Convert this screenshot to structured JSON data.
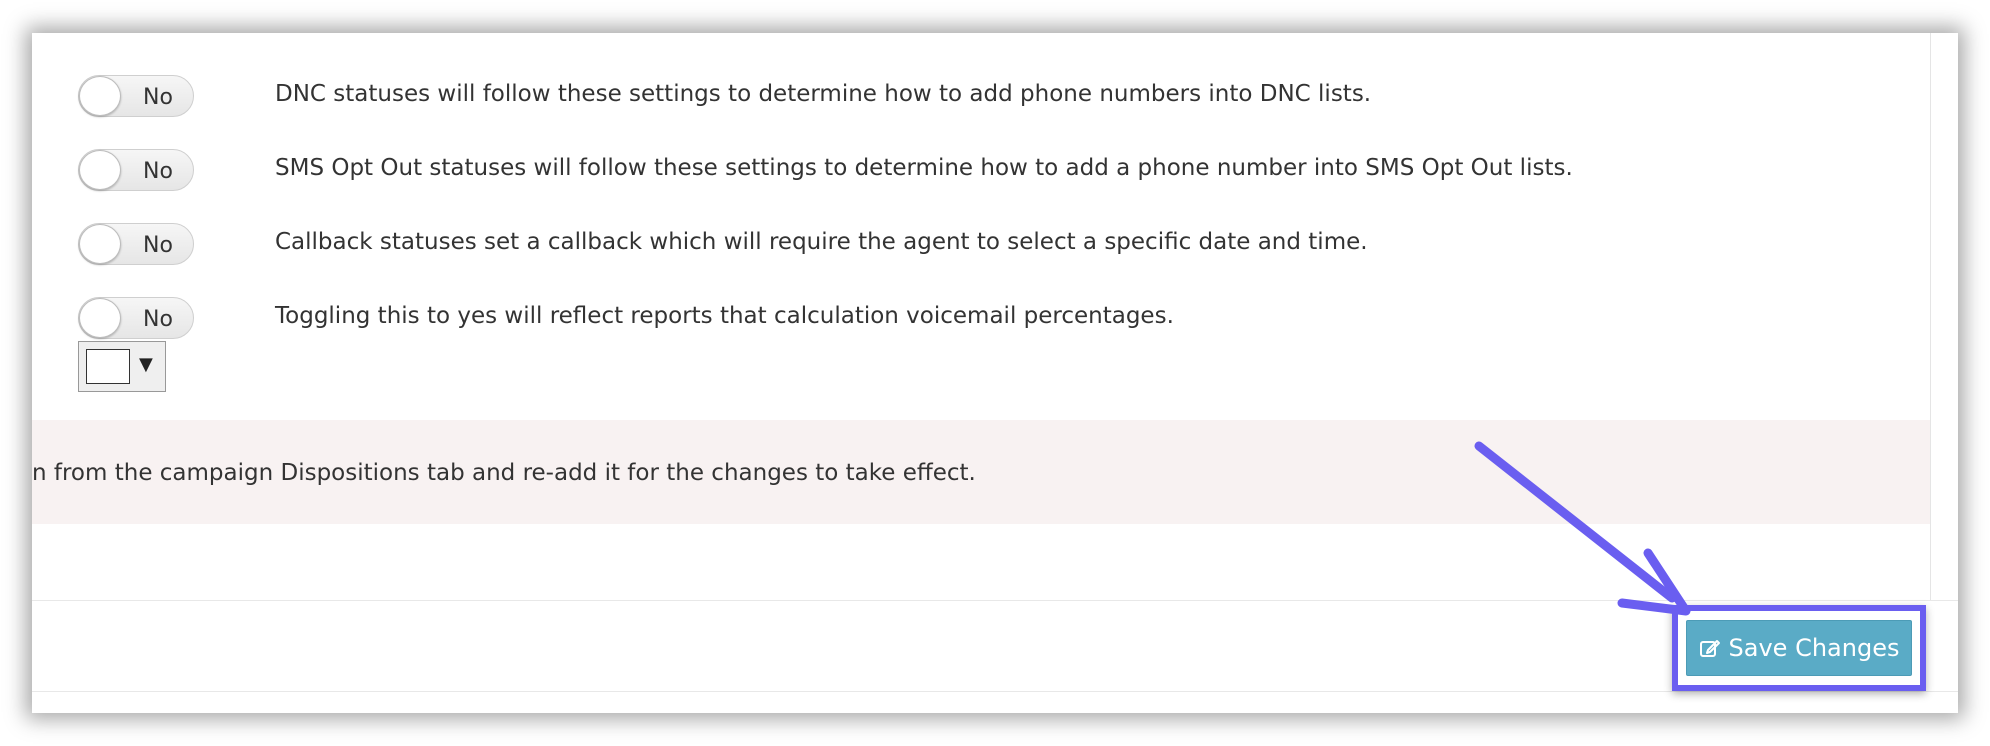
{
  "settings": {
    "rows": [
      {
        "toggle_label": "No",
        "description": "DNC statuses will follow these settings to determine how to add phone numbers into DNC lists."
      },
      {
        "toggle_label": "No",
        "description": "SMS Opt Out statuses will follow these settings to determine how to add a phone number into SMS Opt Out lists."
      },
      {
        "toggle_label": "No",
        "description": "Callback statuses set a callback which will require the agent to select a specific date and time."
      },
      {
        "toggle_label": "No",
        "description": "Toggling this to yes will reflect reports that calculation voicemail percentages."
      }
    ],
    "color_picker": {
      "caret": "▼",
      "value_color": "#ffffff"
    }
  },
  "alert": {
    "text": "n from the campaign Dispositions tab and re-add it for the changes to take effect."
  },
  "footer": {
    "save_label": "Save Changes",
    "save_icon": "edit-icon"
  },
  "colors": {
    "button": "#5aabc6",
    "annotation": "#6a5ef0",
    "alert_bg": "#f8f2f2"
  }
}
